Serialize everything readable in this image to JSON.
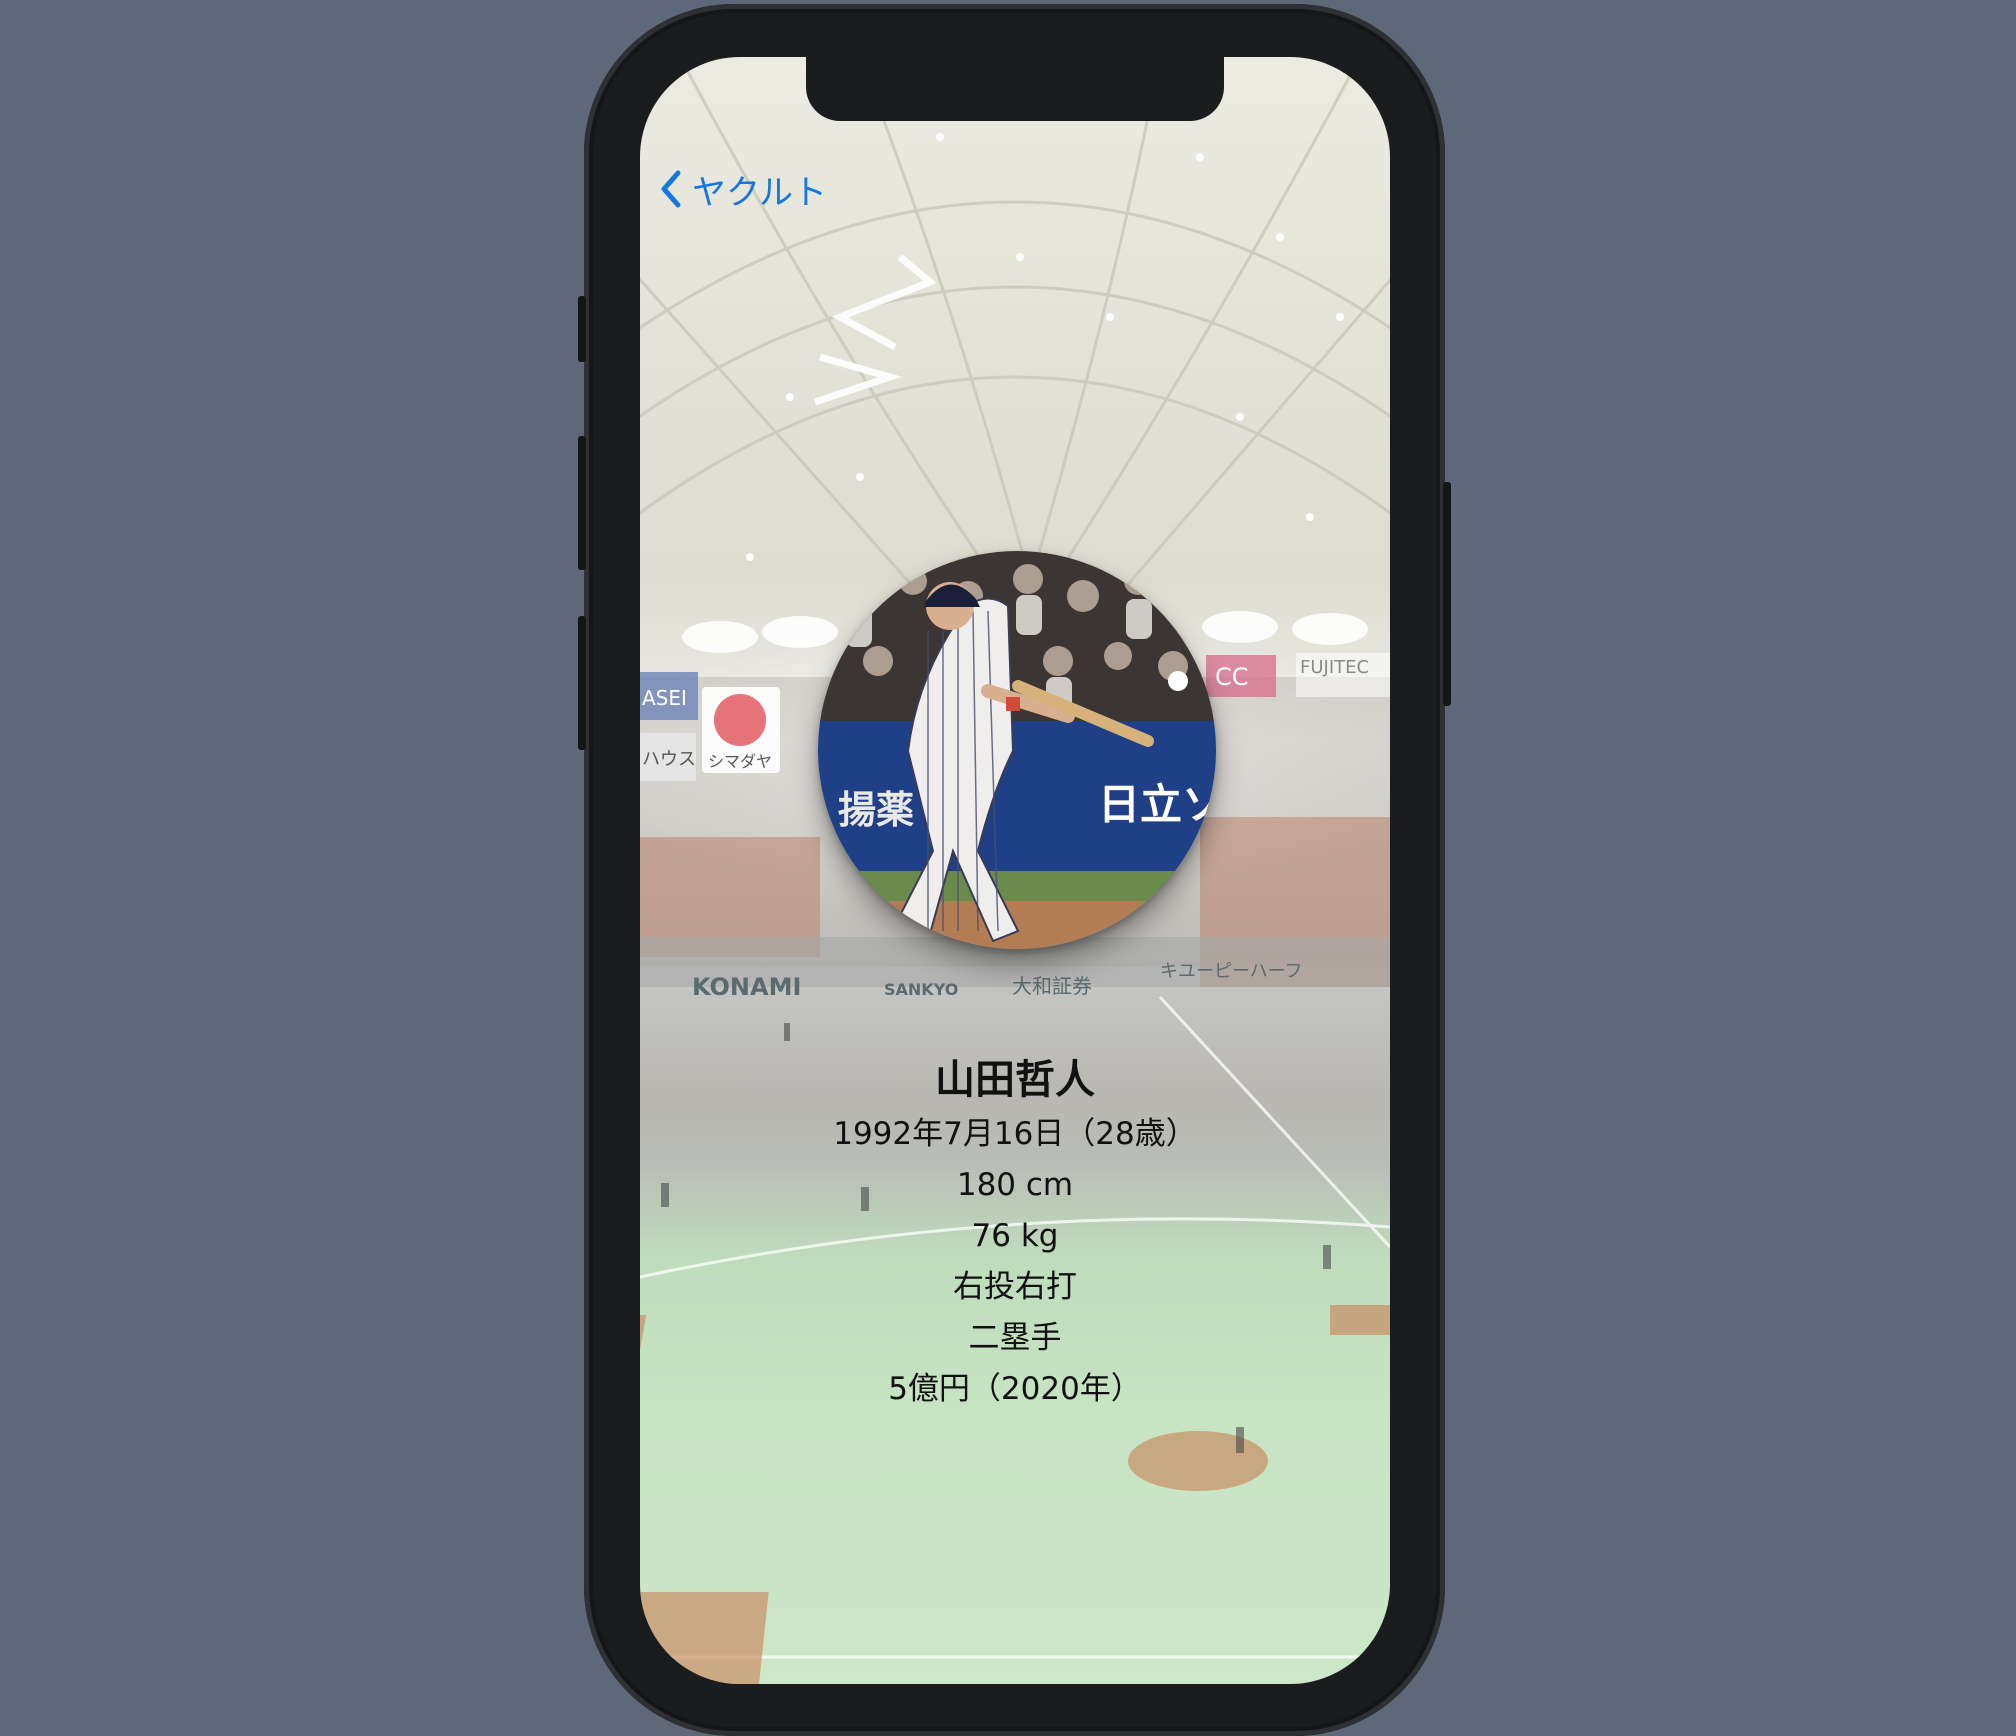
{
  "nav": {
    "back_label": "ヤクルト"
  },
  "player": {
    "name": "山田哲人",
    "birth": "1992年7月16日（28歳）",
    "height": "180 cm",
    "weight": "76 kg",
    "throw_bat": "右投右打",
    "position": "二塁手",
    "salary": "5億円（2020年）"
  },
  "stadium_signs": [
    "KONAMI",
    "SANKYO",
    "大和証券",
    "キユーピーハーフ",
    "FUJITEC",
    "CC",
    "シマダヤ",
    "ASEI",
    "ハウス"
  ],
  "photo_signs": [
    "日立ソ",
    "揚薬"
  ],
  "colors": {
    "accent": "#1677e0",
    "background": "#5e6878",
    "phone": "#1b1c1e"
  }
}
